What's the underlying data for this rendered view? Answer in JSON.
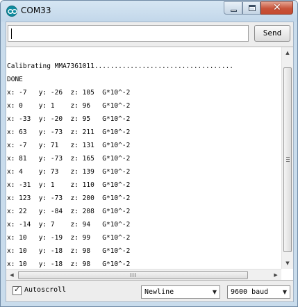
{
  "window": {
    "title": "COM33",
    "icon": "arduino-icon",
    "controls": {
      "minimize": "minimize-icon",
      "maximize": "maximize-icon",
      "close_label": "✕"
    }
  },
  "input": {
    "value": "",
    "placeholder": ""
  },
  "send_button": {
    "label": "Send"
  },
  "log_lines": [
    "Calibrating MMA7361011...................................",
    "DONE",
    "x: -7   y: -26  z: 105  G*10^-2",
    "x: 0    y: 1    z: 96   G*10^-2",
    "x: -33  y: -20  z: 95   G*10^-2",
    "x: 63   y: -73  z: 211  G*10^-2",
    "x: -7   y: 71   z: 131  G*10^-2",
    "x: 81   y: -73  z: 165  G*10^-2",
    "x: 4    y: 73   z: 139  G*10^-2",
    "x: -31  y: 1    z: 110  G*10^-2",
    "x: 123  y: -73  z: 200  G*10^-2",
    "x: 22   y: -84  z: 208  G*10^-2",
    "x: -14  y: 7    z: 94   G*10^-2",
    "x: 10   y: -19  z: 99   G*10^-2",
    "x: 10   y: -18  z: 98   G*10^-2",
    "x: 10   y: -18  z: 98   G*10^-2"
  ],
  "scrollbars": {
    "up": "▲",
    "down": "▼",
    "left": "◀",
    "right": "▶"
  },
  "autoscroll": {
    "label": "Autoscroll",
    "checked": true,
    "mark": "✓"
  },
  "line_ending": {
    "selected": "Newline",
    "arrow": "▼"
  },
  "baud": {
    "selected": "9600 baud",
    "arrow": "▼"
  },
  "colors": {
    "accent": "#0f8ca0",
    "close": "#c8533a",
    "frame": "#c9dcec"
  }
}
